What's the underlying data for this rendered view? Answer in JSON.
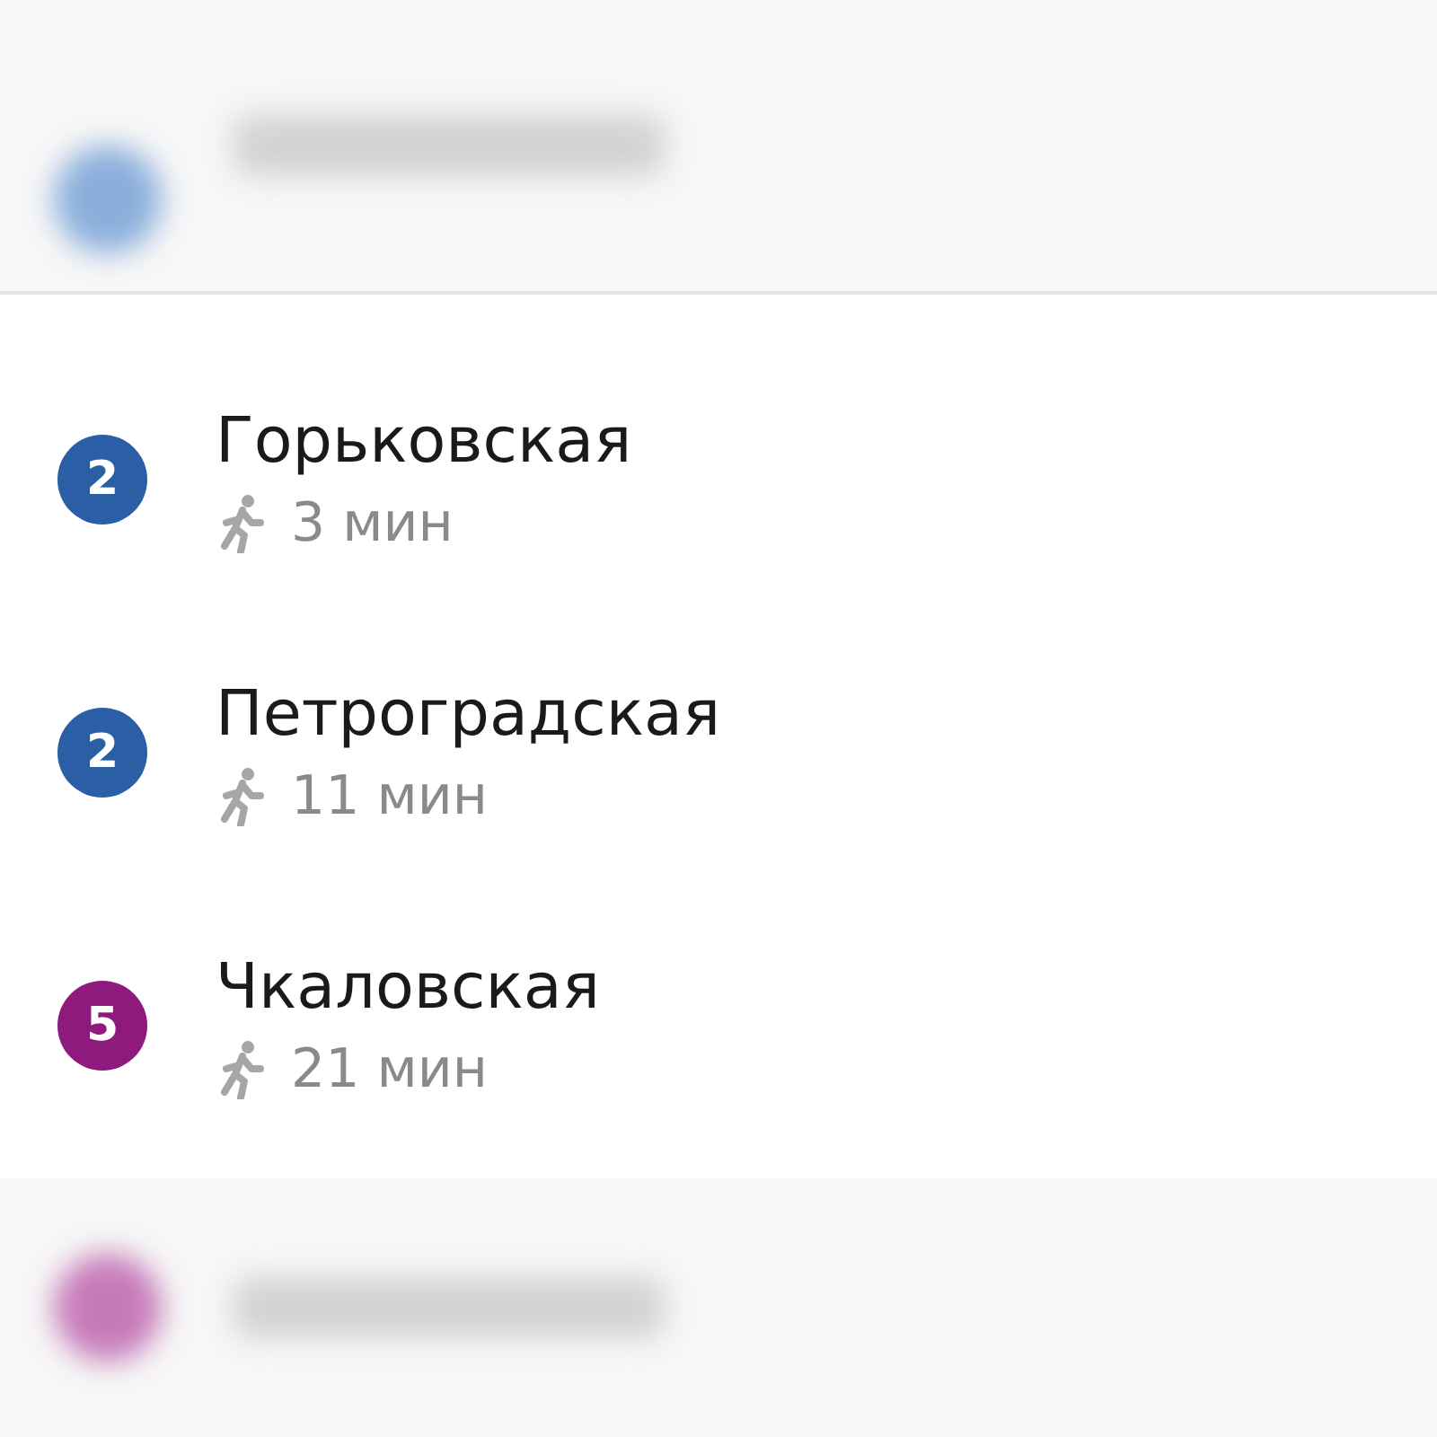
{
  "stations": [
    {
      "line": "2",
      "color": "#2a5fa6",
      "name": "Горьковская",
      "walk_time": "3 мин"
    },
    {
      "line": "2",
      "color": "#2a5fa6",
      "name": "Петроградская",
      "walk_time": "11 мин"
    },
    {
      "line": "5",
      "color": "#8e1a7e",
      "name": "Чкаловская",
      "walk_time": "21 мин"
    }
  ]
}
